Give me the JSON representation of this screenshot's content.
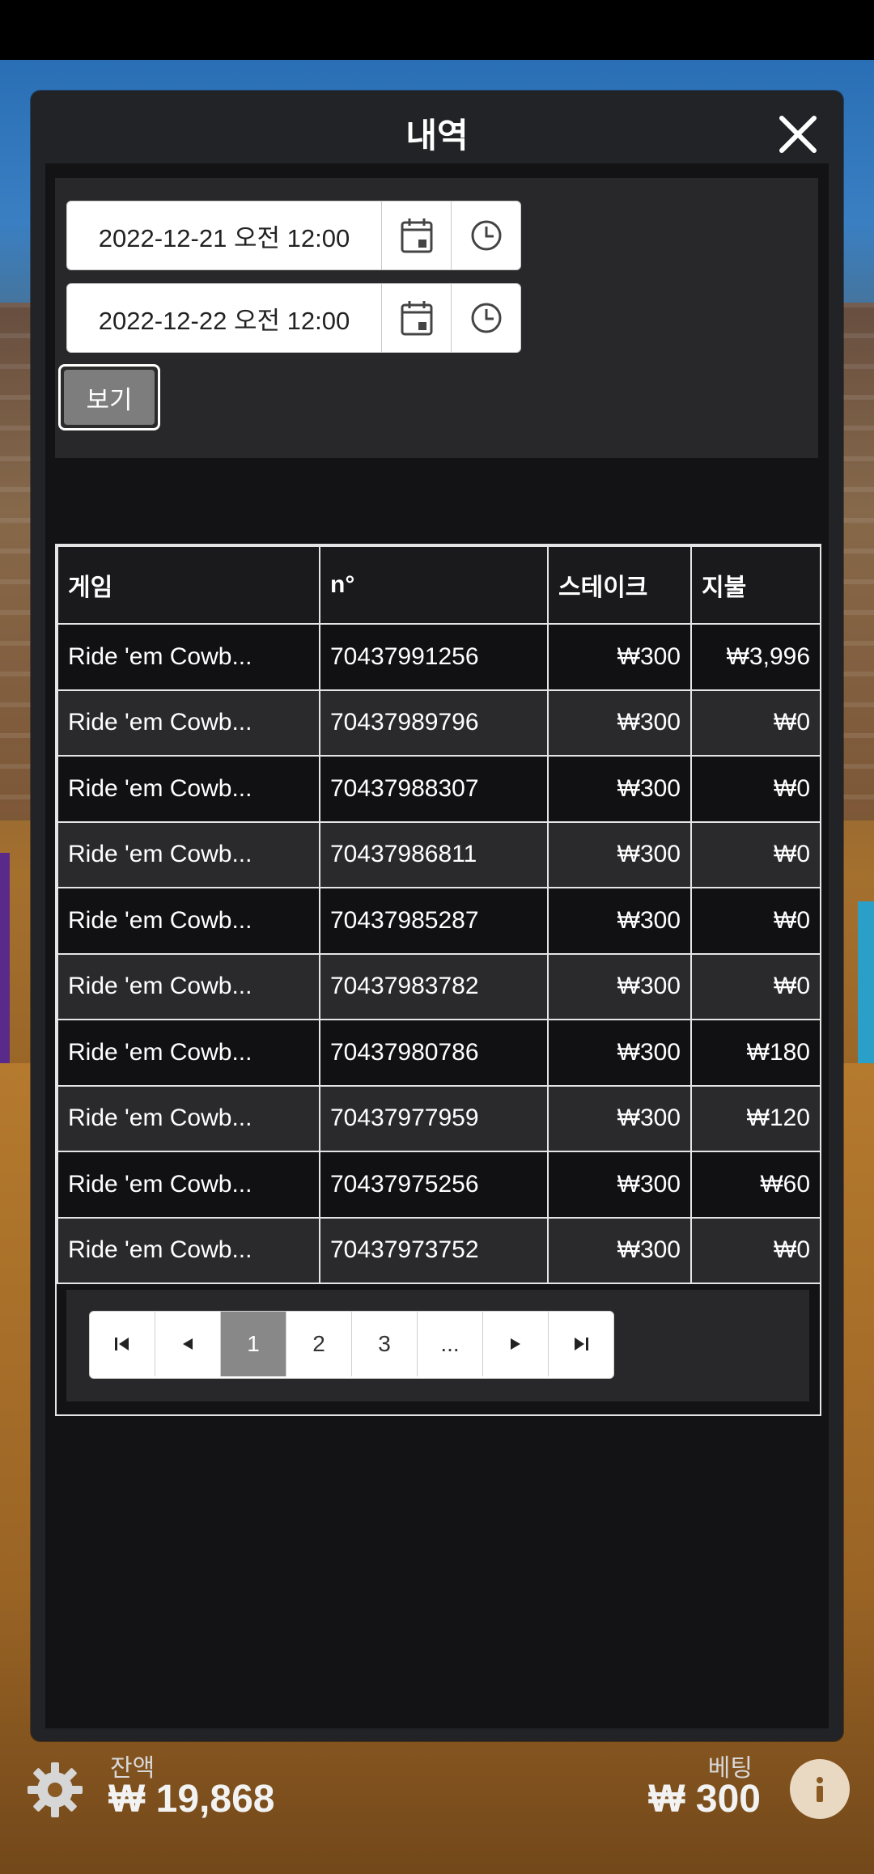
{
  "modal": {
    "title": "내역",
    "close_icon": "close-icon"
  },
  "filter": {
    "start_datetime": "2022-12-21 오전 12:00",
    "end_datetime": "2022-12-22 오전 12:00",
    "calendar_icon": "calendar-icon",
    "clock_icon": "clock-icon",
    "view_label": "보기"
  },
  "table": {
    "headers": {
      "game": "게임",
      "no": "n°",
      "stake": "스테이크",
      "payout": "지불"
    },
    "rows": [
      {
        "game": "Ride 'em Cowb...",
        "no": "70437991256",
        "stake": "₩300",
        "payout": "₩3,996"
      },
      {
        "game": "Ride 'em Cowb...",
        "no": "70437989796",
        "stake": "₩300",
        "payout": "₩0"
      },
      {
        "game": "Ride 'em Cowb...",
        "no": "70437988307",
        "stake": "₩300",
        "payout": "₩0"
      },
      {
        "game": "Ride 'em Cowb...",
        "no": "70437986811",
        "stake": "₩300",
        "payout": "₩0"
      },
      {
        "game": "Ride 'em Cowb...",
        "no": "70437985287",
        "stake": "₩300",
        "payout": "₩0"
      },
      {
        "game": "Ride 'em Cowb...",
        "no": "70437983782",
        "stake": "₩300",
        "payout": "₩0"
      },
      {
        "game": "Ride 'em Cowb...",
        "no": "70437980786",
        "stake": "₩300",
        "payout": "₩180"
      },
      {
        "game": "Ride 'em Cowb...",
        "no": "70437977959",
        "stake": "₩300",
        "payout": "₩120"
      },
      {
        "game": "Ride 'em Cowb...",
        "no": "70437975256",
        "stake": "₩300",
        "payout": "₩60"
      },
      {
        "game": "Ride 'em Cowb...",
        "no": "70437973752",
        "stake": "₩300",
        "payout": "₩0"
      }
    ]
  },
  "pagination": {
    "pages": [
      "1",
      "2",
      "3",
      "..."
    ],
    "current": "1",
    "icons": [
      "first-page-icon",
      "prev-page-icon",
      "next-page-icon",
      "last-page-icon"
    ]
  },
  "footer": {
    "balance_label": "잔액",
    "balance_value": "₩ 19,868",
    "bet_label": "베팅",
    "bet_value": "₩ 300",
    "settings_icon": "gear-icon",
    "info_icon": "info-icon"
  }
}
